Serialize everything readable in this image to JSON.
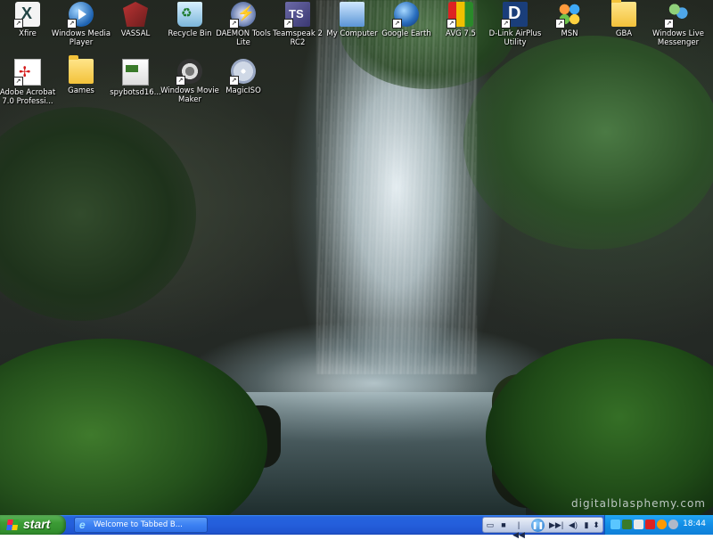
{
  "desktop": {
    "icons": [
      {
        "label": "Xfire",
        "icon": "xfire-icon"
      },
      {
        "label": "Windows Media Player",
        "icon": "windows-media-player-icon"
      },
      {
        "label": "VASSAL",
        "icon": "vassal-icon"
      },
      {
        "label": "Recycle Bin",
        "icon": "recycle-bin-icon"
      },
      {
        "label": "DAEMON Tools Lite",
        "icon": "daemon-tools-icon"
      },
      {
        "label": "Teamspeak 2 RC2",
        "icon": "teamspeak-icon"
      },
      {
        "label": "My Computer",
        "icon": "my-computer-icon"
      },
      {
        "label": "Google Earth",
        "icon": "google-earth-icon"
      },
      {
        "label": "AVG 7.5",
        "icon": "avg-icon"
      },
      {
        "label": "D-Link AirPlus Utility",
        "icon": "dlink-icon"
      },
      {
        "label": "MSN",
        "icon": "msn-icon"
      },
      {
        "label": "GBA",
        "icon": "folder-icon"
      },
      {
        "label": "Windows Live Messenger",
        "icon": "windows-live-messenger-icon"
      },
      {
        "label": "Adobe Acrobat 7.0 Professi...",
        "icon": "adobe-acrobat-icon"
      },
      {
        "label": "Games",
        "icon": "folder-icon"
      },
      {
        "label": "spybotsd16...",
        "icon": "spybot-icon"
      },
      {
        "label": "Windows Movie Maker",
        "icon": "windows-movie-maker-icon"
      },
      {
        "label": "MagicISO",
        "icon": "magiciso-icon"
      }
    ],
    "watermark": "digitalblasphemy.com"
  },
  "taskbar": {
    "start_label": "start",
    "task": {
      "label": "Welcome to Tabbed B..."
    },
    "media": {
      "restore": "▭",
      "stop": "■",
      "prev": "|◀◀",
      "pause": "❚❚",
      "next": "▶▶|",
      "vol": "◀)",
      "seek": "▮",
      "more": "⬍"
    },
    "tray": {
      "clock": "18:44"
    }
  },
  "colors": {
    "taskbar": "#245edb",
    "start": "#3c9b35",
    "tray": "#138ee6"
  }
}
